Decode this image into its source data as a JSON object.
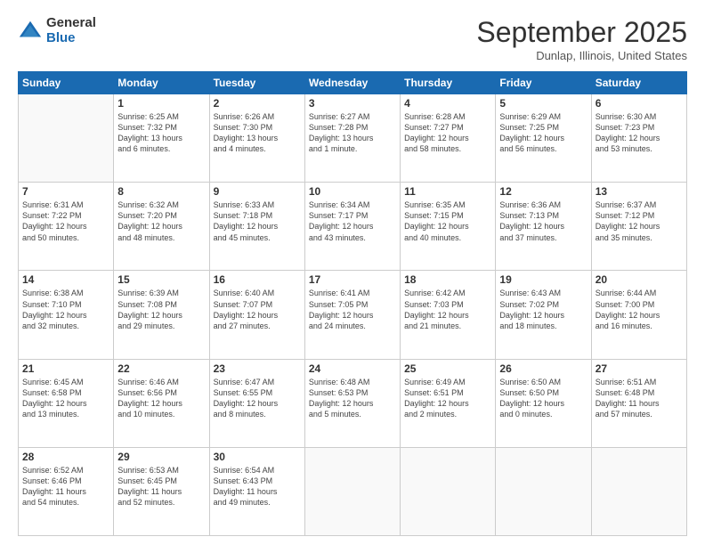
{
  "logo": {
    "general": "General",
    "blue": "Blue"
  },
  "title": "September 2025",
  "location": "Dunlap, Illinois, United States",
  "weekdays": [
    "Sunday",
    "Monday",
    "Tuesday",
    "Wednesday",
    "Thursday",
    "Friday",
    "Saturday"
  ],
  "weeks": [
    [
      {
        "day": "",
        "info": ""
      },
      {
        "day": "1",
        "info": "Sunrise: 6:25 AM\nSunset: 7:32 PM\nDaylight: 13 hours\nand 6 minutes."
      },
      {
        "day": "2",
        "info": "Sunrise: 6:26 AM\nSunset: 7:30 PM\nDaylight: 13 hours\nand 4 minutes."
      },
      {
        "day": "3",
        "info": "Sunrise: 6:27 AM\nSunset: 7:28 PM\nDaylight: 13 hours\nand 1 minute."
      },
      {
        "day": "4",
        "info": "Sunrise: 6:28 AM\nSunset: 7:27 PM\nDaylight: 12 hours\nand 58 minutes."
      },
      {
        "day": "5",
        "info": "Sunrise: 6:29 AM\nSunset: 7:25 PM\nDaylight: 12 hours\nand 56 minutes."
      },
      {
        "day": "6",
        "info": "Sunrise: 6:30 AM\nSunset: 7:23 PM\nDaylight: 12 hours\nand 53 minutes."
      }
    ],
    [
      {
        "day": "7",
        "info": "Sunrise: 6:31 AM\nSunset: 7:22 PM\nDaylight: 12 hours\nand 50 minutes."
      },
      {
        "day": "8",
        "info": "Sunrise: 6:32 AM\nSunset: 7:20 PM\nDaylight: 12 hours\nand 48 minutes."
      },
      {
        "day": "9",
        "info": "Sunrise: 6:33 AM\nSunset: 7:18 PM\nDaylight: 12 hours\nand 45 minutes."
      },
      {
        "day": "10",
        "info": "Sunrise: 6:34 AM\nSunset: 7:17 PM\nDaylight: 12 hours\nand 43 minutes."
      },
      {
        "day": "11",
        "info": "Sunrise: 6:35 AM\nSunset: 7:15 PM\nDaylight: 12 hours\nand 40 minutes."
      },
      {
        "day": "12",
        "info": "Sunrise: 6:36 AM\nSunset: 7:13 PM\nDaylight: 12 hours\nand 37 minutes."
      },
      {
        "day": "13",
        "info": "Sunrise: 6:37 AM\nSunset: 7:12 PM\nDaylight: 12 hours\nand 35 minutes."
      }
    ],
    [
      {
        "day": "14",
        "info": "Sunrise: 6:38 AM\nSunset: 7:10 PM\nDaylight: 12 hours\nand 32 minutes."
      },
      {
        "day": "15",
        "info": "Sunrise: 6:39 AM\nSunset: 7:08 PM\nDaylight: 12 hours\nand 29 minutes."
      },
      {
        "day": "16",
        "info": "Sunrise: 6:40 AM\nSunset: 7:07 PM\nDaylight: 12 hours\nand 27 minutes."
      },
      {
        "day": "17",
        "info": "Sunrise: 6:41 AM\nSunset: 7:05 PM\nDaylight: 12 hours\nand 24 minutes."
      },
      {
        "day": "18",
        "info": "Sunrise: 6:42 AM\nSunset: 7:03 PM\nDaylight: 12 hours\nand 21 minutes."
      },
      {
        "day": "19",
        "info": "Sunrise: 6:43 AM\nSunset: 7:02 PM\nDaylight: 12 hours\nand 18 minutes."
      },
      {
        "day": "20",
        "info": "Sunrise: 6:44 AM\nSunset: 7:00 PM\nDaylight: 12 hours\nand 16 minutes."
      }
    ],
    [
      {
        "day": "21",
        "info": "Sunrise: 6:45 AM\nSunset: 6:58 PM\nDaylight: 12 hours\nand 13 minutes."
      },
      {
        "day": "22",
        "info": "Sunrise: 6:46 AM\nSunset: 6:56 PM\nDaylight: 12 hours\nand 10 minutes."
      },
      {
        "day": "23",
        "info": "Sunrise: 6:47 AM\nSunset: 6:55 PM\nDaylight: 12 hours\nand 8 minutes."
      },
      {
        "day": "24",
        "info": "Sunrise: 6:48 AM\nSunset: 6:53 PM\nDaylight: 12 hours\nand 5 minutes."
      },
      {
        "day": "25",
        "info": "Sunrise: 6:49 AM\nSunset: 6:51 PM\nDaylight: 12 hours\nand 2 minutes."
      },
      {
        "day": "26",
        "info": "Sunrise: 6:50 AM\nSunset: 6:50 PM\nDaylight: 12 hours\nand 0 minutes."
      },
      {
        "day": "27",
        "info": "Sunrise: 6:51 AM\nSunset: 6:48 PM\nDaylight: 11 hours\nand 57 minutes."
      }
    ],
    [
      {
        "day": "28",
        "info": "Sunrise: 6:52 AM\nSunset: 6:46 PM\nDaylight: 11 hours\nand 54 minutes."
      },
      {
        "day": "29",
        "info": "Sunrise: 6:53 AM\nSunset: 6:45 PM\nDaylight: 11 hours\nand 52 minutes."
      },
      {
        "day": "30",
        "info": "Sunrise: 6:54 AM\nSunset: 6:43 PM\nDaylight: 11 hours\nand 49 minutes."
      },
      {
        "day": "",
        "info": ""
      },
      {
        "day": "",
        "info": ""
      },
      {
        "day": "",
        "info": ""
      },
      {
        "day": "",
        "info": ""
      }
    ]
  ]
}
